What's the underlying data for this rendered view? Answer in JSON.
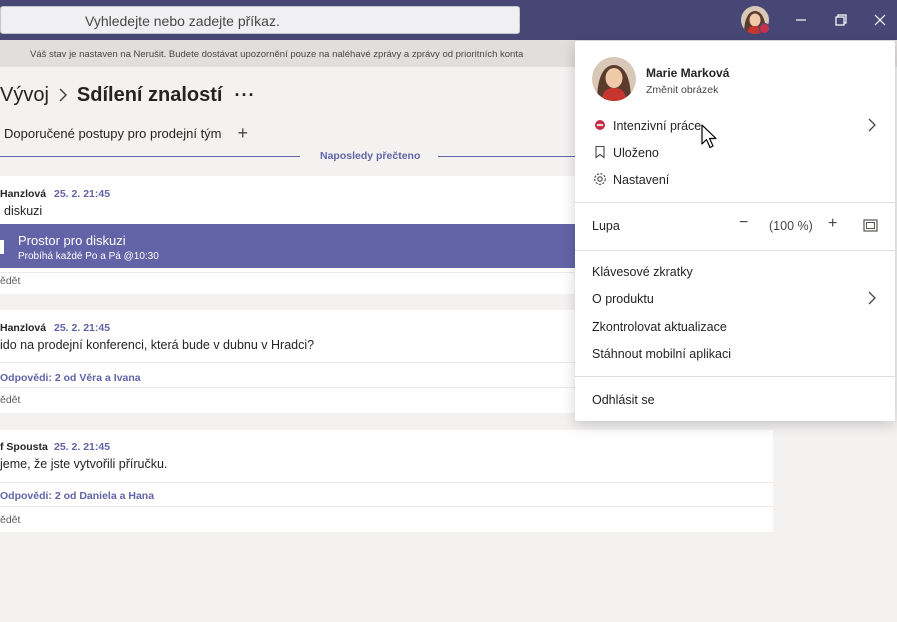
{
  "titlebar": {
    "search_placeholder": "Vyhledejte nebo zadejte příkaz."
  },
  "notice": {
    "text": "Váš stav je nastaven na Nerušit. Budete dostávat upozornění pouze na naléhavé zprávy a zprávy od prioritních konta"
  },
  "header": {
    "team": "Vývoj",
    "channel": "Sdílení znalostí",
    "more": "···"
  },
  "tabs": {
    "first": "Doporučené postupy pro prodejní tým",
    "add": "+"
  },
  "last_read_label": "Naposledy přečteno",
  "posts": [
    {
      "author": "Hanzlová",
      "time": "25. 2. 21:45",
      "text": "diskuzi",
      "meeting_title": "Prostor pro diskuzi",
      "meeting_sub": "Probíhá každé Po a Pá @10:30",
      "reply": "ědět"
    },
    {
      "author": "Hanzlová",
      "time": "25. 2. 21:45",
      "text": "ido na prodejní konferenci, která bude v dubnu v Hradci?",
      "replies": "Odpovědi: 2 od Věra a Ivana",
      "reply": "ědět"
    },
    {
      "author": "f Spousta",
      "time": "25. 2. 21:45",
      "text": "jeme, že jste vytvořili příručku.",
      "replies": "Odpovědi: 2 od Daniela a Hana",
      "reply": "ědět"
    }
  ],
  "menu": {
    "name": "Marie Marková",
    "change_picture": "Změnit obrázek",
    "status": "Intenzivní práce",
    "saved": "Uloženo",
    "settings": "Nastavení",
    "zoom_label": "Lupa",
    "zoom_minus": "−",
    "zoom_value": "(100 %)",
    "zoom_plus": "+",
    "shortcuts": "Klávesové zkratky",
    "about": "O produktu",
    "check_updates": "Zkontrolovat aktualizace",
    "download_mobile": "Stáhnout mobilní aplikaci",
    "sign_out": "Odhlásit se"
  },
  "colors": {
    "titlebar": "#464775",
    "accent": "#6264a7",
    "status_busy": "#c4314b"
  }
}
